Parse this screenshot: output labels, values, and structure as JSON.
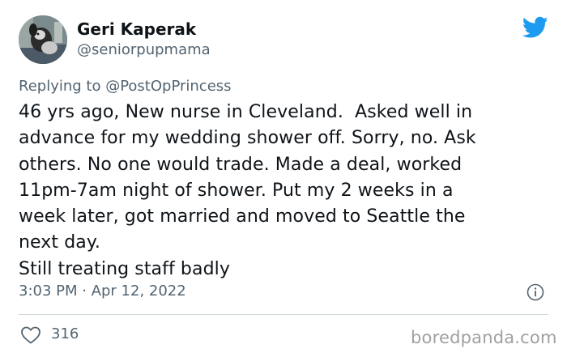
{
  "author": {
    "display_name": "Geri Kaperak",
    "handle": "@seniorpupmama"
  },
  "reply": {
    "prefix": "Replying to ",
    "mention": "@PostOpPrincess"
  },
  "tweet": {
    "text": "46 yrs ago, New nurse in Cleveland.  Asked well in\nadvance for my wedding shower off. Sorry, no. Ask\nothers. No one would trade. Made a deal, worked\n11pm-7am night of shower. Put my 2 weeks in a\nweek later, got married and moved to Seattle the\nnext day.\nStill treating staff badly",
    "timestamp": "3:03 PM · Apr 12, 2022"
  },
  "engagement": {
    "likes": "316"
  },
  "watermark": "boredpanda.com",
  "icons": {
    "brand": "twitter-bird-icon",
    "info": "info-icon",
    "like": "heart-icon"
  },
  "colors": {
    "twitter_blue": "#1d9bf0",
    "text_primary": "#0f1419",
    "text_secondary": "#536471",
    "divider": "#cfd9de"
  }
}
